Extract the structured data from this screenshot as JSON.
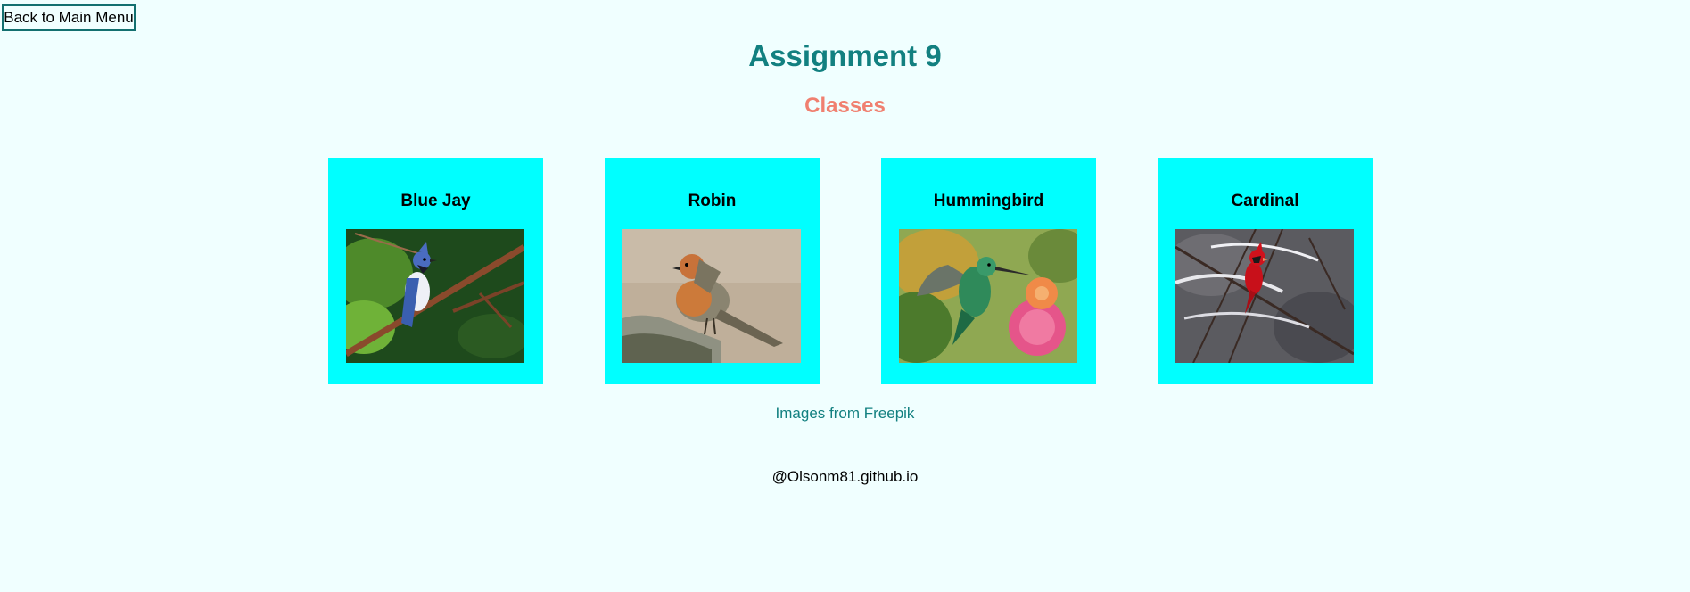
{
  "nav": {
    "back_label": "Back to Main Menu"
  },
  "header": {
    "title": "Assignment 9",
    "subtitle": "Classes"
  },
  "cards": [
    {
      "name": "Blue Jay"
    },
    {
      "name": "Robin"
    },
    {
      "name": "Hummingbird"
    },
    {
      "name": "Cardinal"
    }
  ],
  "credit": "Images from Freepik",
  "footer": "@Olsonm81.github.io",
  "colors": {
    "background": "#f0ffff",
    "title": "#128080",
    "subtitle": "#f08070",
    "card": "#00ffff",
    "button_border": "#137070"
  }
}
